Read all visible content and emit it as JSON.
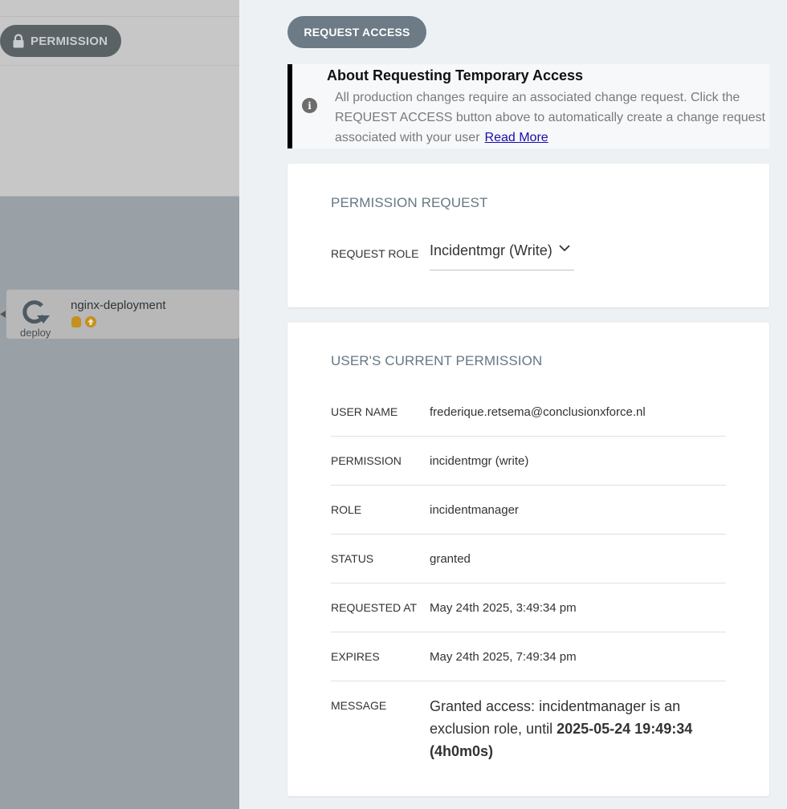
{
  "background_app": {
    "permission_pill_label": "PERMISSION",
    "node": {
      "name": "nginx-deployment",
      "type_label": "deploy"
    }
  },
  "panel": {
    "request_button_label": "REQUEST ACCESS",
    "info": {
      "title": "About Requesting Temporary Access",
      "body": "All production changes require an associated change request. Click the REQUEST ACCESS button above to automatically create a change request associated with your user",
      "link_label": "Read More"
    },
    "permission_request": {
      "title": "PERMISSION REQUEST",
      "role_label": "REQUEST ROLE",
      "role_value": "Incidentmgr (Write)"
    },
    "current_permission": {
      "title": "USER'S CURRENT PERMISSION",
      "rows": [
        {
          "label": "USER NAME",
          "value": "frederique.retsema@conclusionxforce.nl"
        },
        {
          "label": "PERMISSION",
          "value": "incidentmgr (write)"
        },
        {
          "label": "ROLE",
          "value": "incidentmanager"
        },
        {
          "label": "STATUS",
          "value": "granted"
        },
        {
          "label": "REQUESTED AT",
          "value": "May 24th 2025, 3:49:34 pm"
        },
        {
          "label": "EXPIRES",
          "value": "May 24th 2025, 7:49:34 pm"
        }
      ],
      "message": {
        "label": "MESSAGE",
        "text_prefix": "Granted access: incidentmanager is an exclusion role, until ",
        "text_bold": "2025-05-24 19:49:34 (4h0m0s)"
      }
    }
  },
  "colors": {
    "request_button": "#6c7b86",
    "card_title": "#657883",
    "badge": "#c4901f",
    "link": "#1a0dab"
  }
}
